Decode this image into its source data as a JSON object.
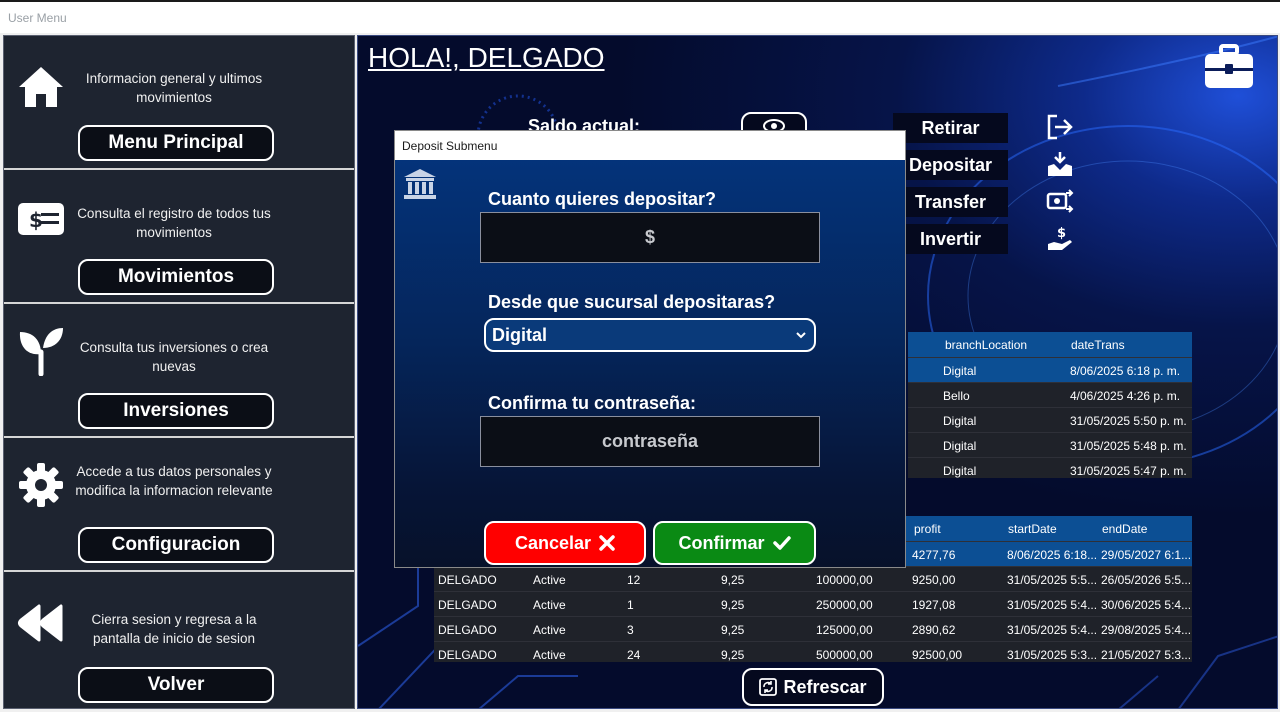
{
  "window": {
    "title": "User Menu"
  },
  "sidebar": {
    "sections": [
      {
        "description": "Informacion general y ultimos movimientos",
        "button": "Menu Principal",
        "icon": "home-icon"
      },
      {
        "description": "Consulta el registro de todos tus movimientos",
        "button": "Movimientos",
        "icon": "money-icon"
      },
      {
        "description": "Consulta tus inversiones o crea nuevas",
        "button": "Inversiones",
        "icon": "sprout-icon"
      },
      {
        "description": "Accede a tus datos personales y modifica la informacion relevante",
        "button": "Configuracion",
        "icon": "gear-icon"
      },
      {
        "description": "Cierra sesion y regresa a la pantalla de inicio de sesion",
        "button": "Volver",
        "icon": "rewind-icon"
      }
    ]
  },
  "main": {
    "greeting": "HOLA!, DELGADO",
    "balance_label": "Saldo actual:",
    "actions": [
      {
        "label": "Retirar",
        "icon": "logout-icon"
      },
      {
        "label": "Depositar",
        "icon": "deposit-icon"
      },
      {
        "label": "Transfer",
        "icon": "transfer-icon"
      },
      {
        "label": "Invertir",
        "icon": "invest-hand-icon"
      }
    ],
    "transactions": {
      "columns": [
        "branchLocation",
        "dateTrans"
      ],
      "rows": [
        [
          "Digital",
          "8/06/2025 6:18 p. m."
        ],
        [
          "Bello",
          "4/06/2025 4:26 p. m."
        ],
        [
          "Digital",
          "31/05/2025 5:50 p. m."
        ],
        [
          "Digital",
          "31/05/2025 5:48 p. m."
        ],
        [
          "Digital",
          "31/05/2025 5:47 p. m."
        ]
      ]
    },
    "investments": {
      "columns": [
        "profit",
        "startDate",
        "endDate"
      ],
      "first_row": [
        "4277,76",
        "8/06/2025 6:18...",
        "29/05/2027 6:1..."
      ],
      "rows": [
        [
          "DELGADO",
          "Active",
          "12",
          "9,25",
          "100000,00",
          "9250,00",
          "31/05/2025 5:5...",
          "26/05/2026 5:5..."
        ],
        [
          "DELGADO",
          "Active",
          "1",
          "9,25",
          "250000,00",
          "1927,08",
          "31/05/2025 5:4...",
          "30/06/2025 5:4..."
        ],
        [
          "DELGADO",
          "Active",
          "3",
          "9,25",
          "125000,00",
          "2890,62",
          "31/05/2025 5:4...",
          "29/08/2025 5:4..."
        ],
        [
          "DELGADO",
          "Active",
          "24",
          "9,25",
          "500000,00",
          "92500,00",
          "31/05/2025 5:3...",
          "21/05/2027 5:3..."
        ]
      ]
    },
    "refresh_label": "Refrescar"
  },
  "modal": {
    "title": "Deposit Submenu",
    "amount_label": "Cuanto quieres depositar?",
    "amount_value": "$",
    "branch_label": "Desde que sucursal depositaras?",
    "branch_selected": "Digital",
    "password_label": "Confirma tu contraseña:",
    "password_placeholder": "contraseña",
    "cancel_label": "Cancelar",
    "confirm_label": "Confirmar",
    "cancel_color": "#ff0000",
    "confirm_color": "#0a8a14"
  }
}
